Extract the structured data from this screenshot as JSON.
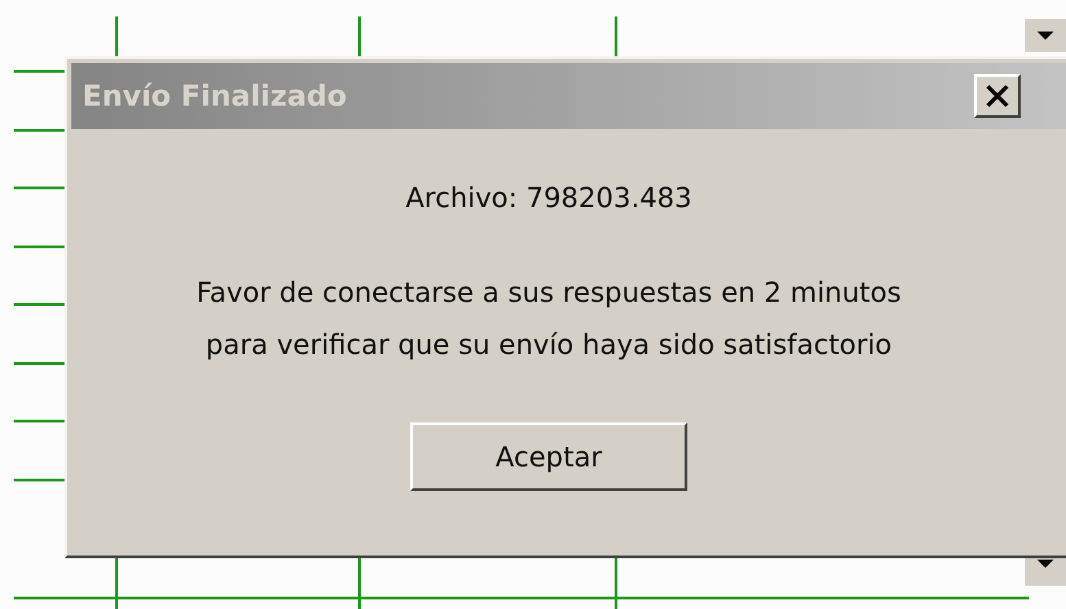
{
  "dialog": {
    "title": "Envío Finalizado",
    "file_line": "Archivo: 798203.483",
    "message_lines": [
      "Favor de conectarse a sus respuestas en 2 minutos",
      "para verificar que su envío haya sido satisfactorio"
    ],
    "buttons": [
      "Aceptar"
    ]
  }
}
